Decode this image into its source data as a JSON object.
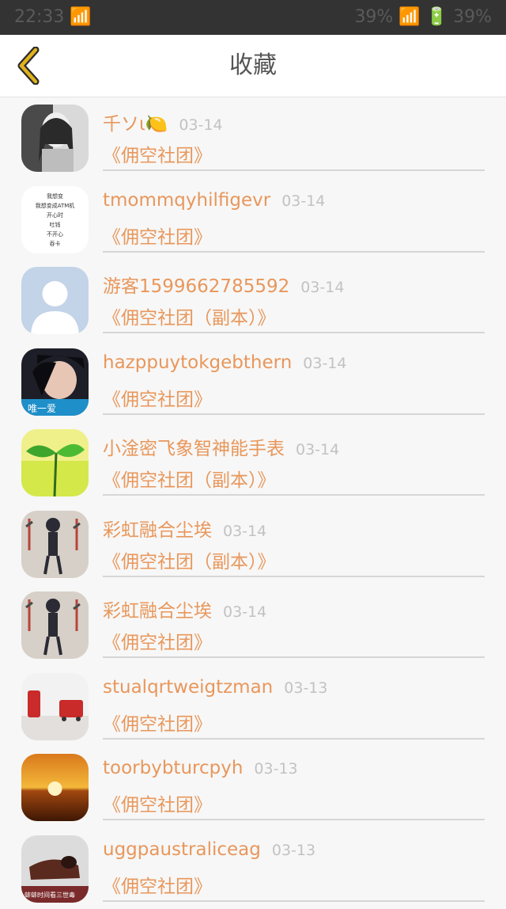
{
  "statusbar": {
    "left": "22:33 📶",
    "right": "39%  📶  🔋 39%"
  },
  "header": {
    "title": "收藏",
    "back_icon": "chevron-left-icon",
    "accent": "#e0b21c"
  },
  "colors": {
    "accent": "#e8975b",
    "time": "#c2c2c2",
    "divider": "#d6d6d6"
  },
  "items": [
    {
      "nick": "千ソι🍋",
      "time": "03-14",
      "group": "《佣空社团》"
    },
    {
      "nick": "tmommqyhilfigevr",
      "time": "03-14",
      "group": "《佣空社团》"
    },
    {
      "nick": "游客1599662785592",
      "time": "03-14",
      "group": "《佣空社团（副本）》"
    },
    {
      "nick": "hazppuytokgebthern",
      "time": "03-14",
      "group": "《佣空社团》"
    },
    {
      "nick": "小淦密飞象智神能手表",
      "time": "03-14",
      "group": "《佣空社团（副本）》"
    },
    {
      "nick": "彩虹融合尘埃",
      "time": "03-14",
      "group": "《佣空社团（副本）》"
    },
    {
      "nick": "彩虹融合尘埃",
      "time": "03-14",
      "group": "《佣空社团》"
    },
    {
      "nick": "stualqrtweigtzman",
      "time": "03-13",
      "group": "《佣空社团》"
    },
    {
      "nick": "toorbybturcpyh",
      "time": "03-13",
      "group": "《佣空社团》"
    },
    {
      "nick": "uggpaustraliceag",
      "time": "03-13",
      "group": "《佣空社团》"
    }
  ],
  "avatar_texts": {
    "atm": [
      "我想变",
      "我想变成ATM机",
      "开心时",
      "吐钱",
      "不开心",
      "吞卡"
    ],
    "unique_love": "唯一爱",
    "last_caption": "蚌蚌时间看三世毒"
  }
}
